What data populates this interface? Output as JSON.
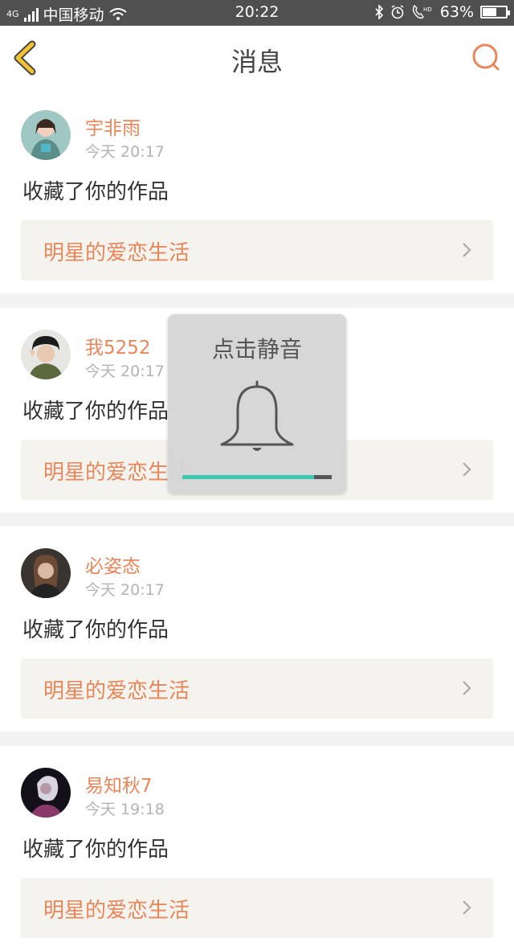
{
  "status_bar": {
    "network": "4G",
    "carrier": "中国移动",
    "time": "20:22",
    "battery_text": "63%",
    "battery_level": 0.63,
    "icons": [
      "bluetooth-icon",
      "alarm-icon",
      "hd-call-icon",
      "battery-icon"
    ]
  },
  "header": {
    "title": "消息",
    "back_icon": "chevron-left-icon",
    "search_icon": "search-icon"
  },
  "messages": [
    {
      "user": "宇非雨",
      "time": "今天 20:17",
      "action": "收藏了你的作品",
      "work": "明星的爱恋生活"
    },
    {
      "user": "我5252",
      "time": "今天 20:17",
      "action": "收藏了你的作品",
      "work": "明星的爱恋生活"
    },
    {
      "user": "必姿态",
      "time": "今天 20:17",
      "action": "收藏了你的作品",
      "work": "明星的爱恋生活"
    },
    {
      "user": "易知秋7",
      "time": "今天 19:18",
      "action": "收藏了你的作品",
      "work": "明星的爱恋生活"
    }
  ],
  "volume_popup": {
    "title": "点击静音",
    "icon": "bell-icon",
    "level": 0.88
  },
  "colors": {
    "accent": "#e8865a",
    "back_icon": "#f1c232",
    "volume_fill": "#3cc8b0"
  }
}
